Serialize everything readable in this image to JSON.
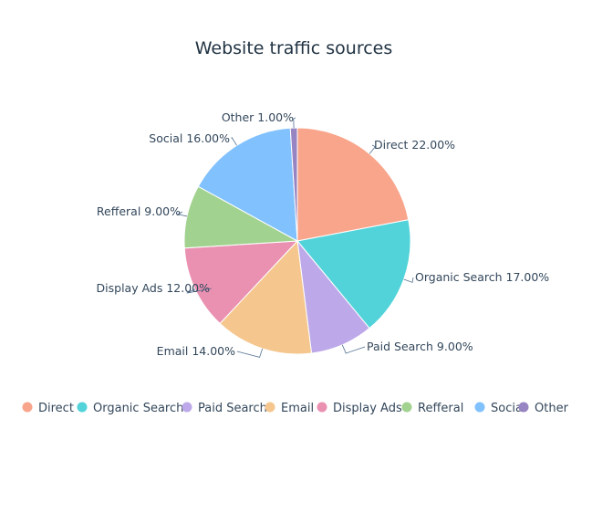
{
  "chart_data": {
    "type": "pie",
    "title": "Website traffic sources",
    "categories": [
      "Direct",
      "Organic Search",
      "Paid Search",
      "Email",
      "Display Ads",
      "Refferal",
      "Social",
      "Other"
    ],
    "values": [
      22,
      17,
      9,
      14,
      12,
      9,
      16,
      1
    ],
    "data_labels": [
      "Direct 22.00%",
      "Organic Search 17.00%",
      "Paid Search 9.00%",
      "Email 14.00%",
      "Display Ads 12.00%",
      "Refferal 9.00%",
      "Social 16.00%",
      "Other 1.00%"
    ],
    "colors": [
      "#f8a58b",
      "#51d3d9",
      "#bda9e9",
      "#f5c78e",
      "#ea90b1",
      "#a2d28f",
      "#81c1fd",
      "#9784c2"
    ],
    "start_angle_deg": 0,
    "direction": "clockwise",
    "legend_position": "bottom"
  }
}
